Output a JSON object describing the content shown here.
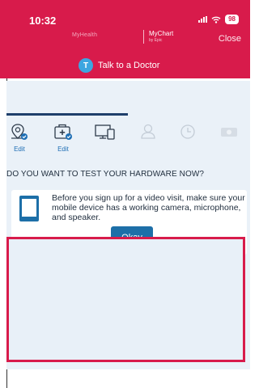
{
  "status_bar": {
    "time": "10:32",
    "battery": "98"
  },
  "header": {
    "brand_left": "MyHealth",
    "brand_right": "MyChart",
    "brand_right_by": "by Epic",
    "close_label": "Close",
    "talk_avatar_initial": "T",
    "talk_label": "Talk to a Doctor"
  },
  "steps": [
    {
      "icon": "location-icon",
      "label": "Edit",
      "state": "done"
    },
    {
      "icon": "medical-kit-icon",
      "label": "Edit",
      "state": "done"
    },
    {
      "icon": "devices-icon",
      "label": "",
      "state": "current"
    },
    {
      "icon": "person-icon",
      "label": "",
      "state": "upcoming"
    },
    {
      "icon": "clock-icon",
      "label": "",
      "state": "upcoming"
    },
    {
      "icon": "payment-icon",
      "label": "",
      "state": "upcoming"
    }
  ],
  "main": {
    "question": "DO YOU WANT TO TEST YOUR HARDWARE NOW?",
    "card_text": "Before you sign up for a video visit, make sure your mobile device has a working camera, microphone, and speaker.",
    "okay_label": "Okay"
  },
  "colors": {
    "header_red": "#d81b4b",
    "accent_blue": "#1d6fa8",
    "panel_blue": "#eaf1f8"
  }
}
